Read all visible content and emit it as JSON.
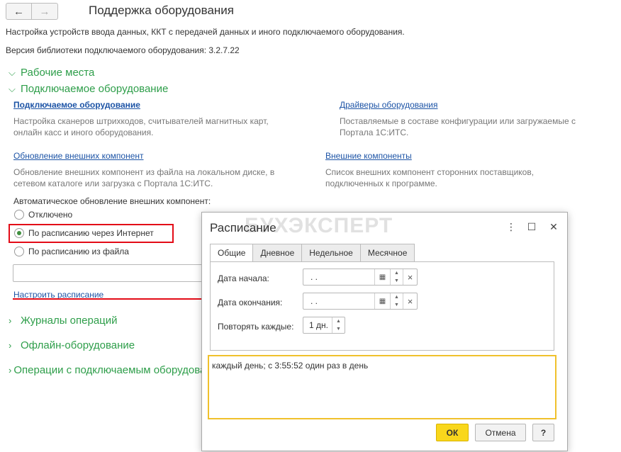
{
  "header": {
    "back_icon": "←",
    "forward_icon": "→",
    "title": "Поддержка оборудования"
  },
  "intro": {
    "description": "Настройка устройств ввода данных, ККТ с передачей данных и иного подключаемого оборудования.",
    "version": "Версия библиотеки подключаемого оборудования: 3.2.7.22"
  },
  "groups": {
    "workplaces": "Рабочие места",
    "equipment": "Подключаемое оборудование",
    "journals": "Журналы операций",
    "offline": "Офлайн-оборудование",
    "operations": "Операции с подключаемым оборудованием"
  },
  "equipment_section": {
    "equipment_link": "Подключаемое оборудование",
    "equipment_desc": [
      "Настройка сканеров штрихкодов, считывателей магнитных карт,",
      "онлайн касс и иного оборудования."
    ],
    "drivers_link": "Драйверы оборудования",
    "drivers_desc": [
      "Поставляемые в составе конфигурации или загружаемые с",
      "Портала 1С:ИТС."
    ],
    "update_link": "Обновление внешних компонент",
    "update_desc": [
      "Обновление внешних компонент из файла на локальном диске, в",
      "сетевом каталоге или загрузка с Портала 1С:ИТС."
    ],
    "components_link": "Внешние компоненты",
    "components_desc": [
      "Список внешних компонент сторонних поставщиков,",
      "подключенных к программе."
    ],
    "auto_update_label": "Автоматическое обновление внешних компонент:",
    "radio_options": [
      "Отключено",
      "По расписанию через Интернет",
      "По расписанию из файла"
    ],
    "selected_index": 1,
    "file_path_value": "",
    "schedule_link": "Настроить расписание"
  },
  "dialog": {
    "title": "Расписание",
    "watermark": "БУХЭКСПЕРТ",
    "menu_icon": "⋮",
    "maximize_icon": "☐",
    "close_icon": "✕",
    "tabs": [
      "Общие",
      "Дневное",
      "Недельное",
      "Месячное"
    ],
    "active_tab": 0,
    "start_date_label": "Дата начала:",
    "start_date_value": " .  .",
    "end_date_label": "Дата окончания:",
    "end_date_value": " .  .",
    "repeat_label": "Повторять каждые:",
    "repeat_value": "1 дн.",
    "calendar_icon": "▦",
    "clear_icon": "×",
    "spin_up_icon": "▲",
    "spin_down_icon": "▼",
    "schedule_text": "каждый день; с 3:55:52 один раз в день",
    "ok_label": "ОК",
    "cancel_label": "Отмена",
    "help_label": "?"
  },
  "colors": {
    "group_green": "#2e9e4a",
    "link_blue": "#1d54a6",
    "highlight_red": "#e30b17",
    "ok_yellow": "#f9d71c",
    "memo_border": "#f0c12c"
  }
}
